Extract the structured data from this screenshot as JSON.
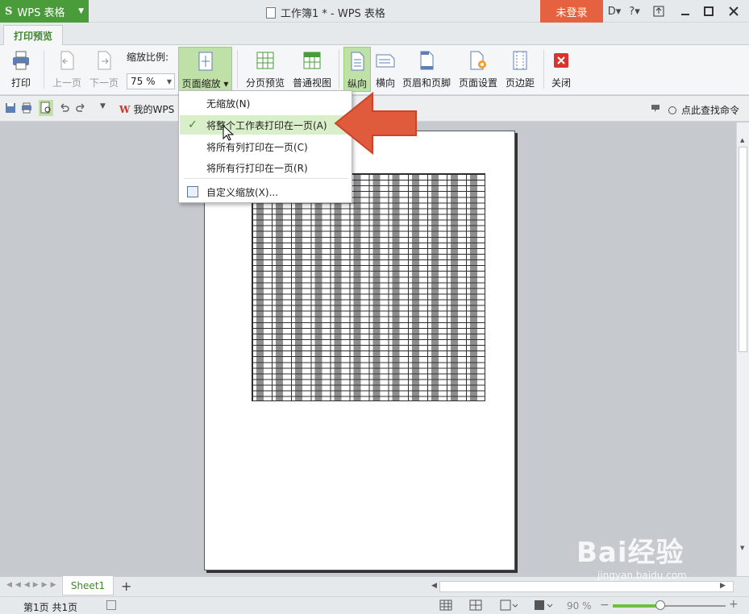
{
  "titlebar": {
    "app_menu": "WPS 表格",
    "doc_title": "工作簿1 * - WPS 表格",
    "login": "未登录",
    "help": "?"
  },
  "tabs": [
    "打印预览"
  ],
  "ribbon": {
    "print": "打印",
    "prev_page": "上一页",
    "next_page": "下一页",
    "zoom_label": "缩放比例:",
    "zoom_value": "75 %",
    "page_scale": "页面缩放",
    "page_break_preview": "分页预览",
    "normal_view": "普通视图",
    "portrait": "纵向",
    "landscape": "横向",
    "header_footer": "页眉和页脚",
    "page_setup": "页面设置",
    "margins": "页边距",
    "close": "关闭"
  },
  "qat": {
    "my_wps": "我的WPS",
    "find_command": "点此查找命令"
  },
  "scale_menu": {
    "items": [
      {
        "label": "无缩放(N)",
        "checked": false
      },
      {
        "label": "将整个工作表打印在一页(A)",
        "checked": true
      },
      {
        "label": "将所有列打印在一页(C)",
        "checked": false
      },
      {
        "label": "将所有行打印在一页(R)",
        "checked": false
      },
      {
        "label": "自定义缩放(X)...",
        "checked": false
      }
    ]
  },
  "sheet_tabs": {
    "active": "Sheet1",
    "add": "+"
  },
  "status": {
    "page_info": "第1页 共1页",
    "zoom": "90 %",
    "zoom_level": 0.42
  },
  "watermark": {
    "brand": "Bai经验",
    "url": "jingyan.baidu.com"
  },
  "colors": {
    "wps_green": "#4a9b3a",
    "login_red": "#e5613f",
    "arrow_red": "#e05a3c",
    "hover_green": "#d9efc9"
  }
}
